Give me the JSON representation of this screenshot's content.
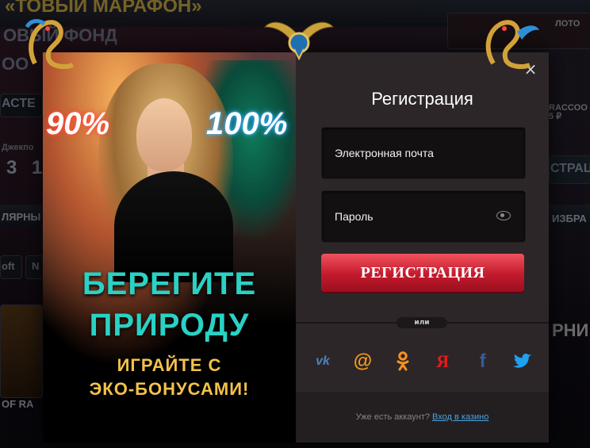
{
  "background": {
    "top_banner": "«ТОВЫЙ МАРАФОН»",
    "left_fragments": [
      "ОВЫЙ ФОНД",
      "ОО",
      "АСТЕ",
      "Джекпо",
      "3 1",
      "ЛЯРНЫ",
      "oft",
      "N",
      "OF RA"
    ],
    "right_fragments": [
      "ЛОТО",
      "RACCOO",
      "5 ₽",
      "СТРАЦ",
      "ИЗБРА",
      "РНИ"
    ]
  },
  "promo": {
    "percent_left": "90%",
    "percent_right": "100%",
    "headline_line1": "БЕРЕГИТЕ",
    "headline_line2": "ПРИРОДУ",
    "sub_line1": "ИГРАЙТЕ С",
    "sub_line2": "ЭКО-БОНУСАМИ!"
  },
  "form": {
    "close_symbol": "×",
    "title": "Регистрация",
    "email_label": "Электронная почта",
    "password_label": "Пароль",
    "submit_label": "РЕГИСТРАЦИЯ",
    "or_label": "или",
    "social": [
      {
        "name": "vk-icon",
        "glyph": "vk",
        "color": "#5181b8"
      },
      {
        "name": "mail-icon",
        "glyph": "@",
        "color": "#f39a1c"
      },
      {
        "name": "odnoklassniki-icon",
        "glyph": "ok",
        "color": "#f7931e"
      },
      {
        "name": "yandex-icon",
        "glyph": "Я",
        "color": "#e61b1b"
      },
      {
        "name": "facebook-icon",
        "glyph": "f",
        "color": "#3b5998"
      },
      {
        "name": "twitter-icon",
        "glyph": "🐦",
        "color": "#1da1f2"
      }
    ],
    "footer_text": "Уже есть аккаунт?",
    "footer_link": "Вход в казино"
  },
  "colors": {
    "accent_red": "#c31a2d",
    "link_blue": "#4aa3df",
    "promo_teal": "#29d2c4",
    "promo_gold": "#f3c24b"
  }
}
